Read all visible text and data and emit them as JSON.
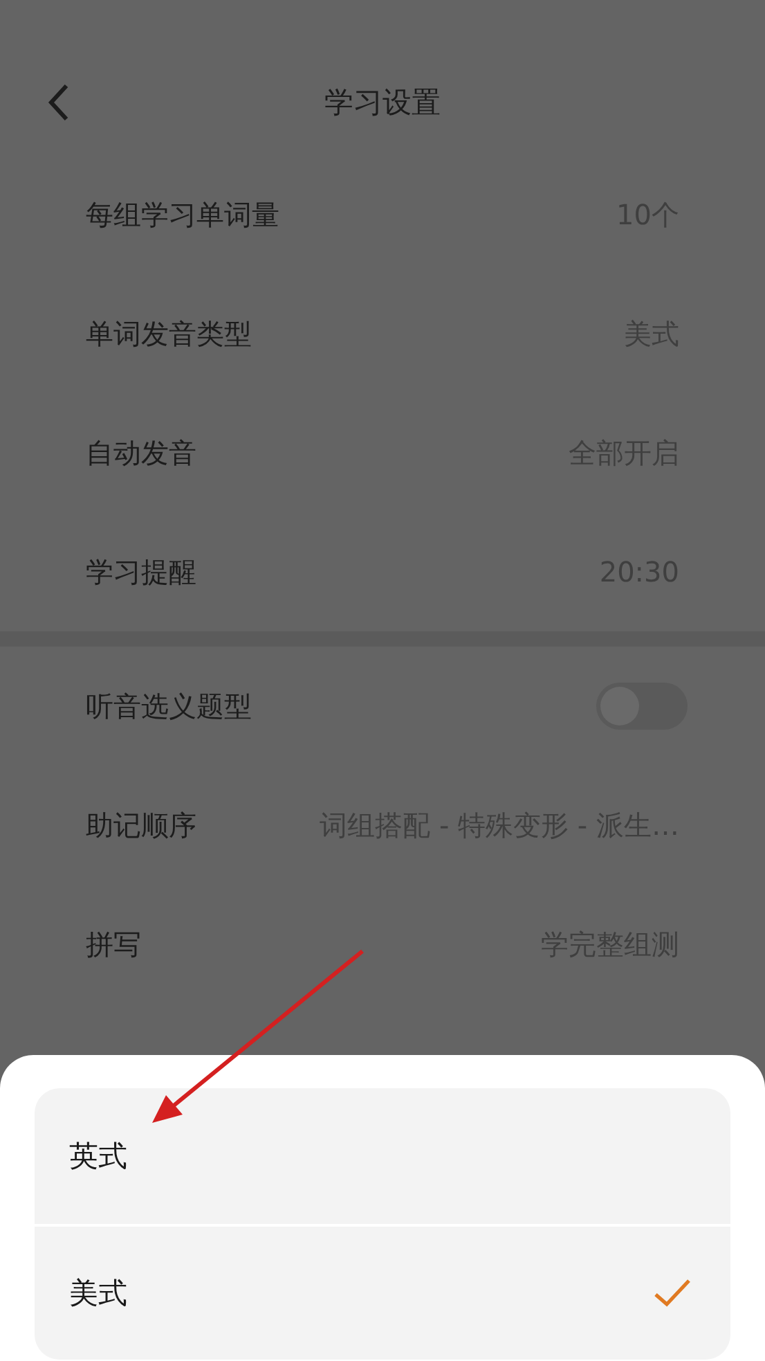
{
  "header": {
    "title": "学习设置"
  },
  "groups": [
    {
      "rows": [
        {
          "kind": "value",
          "label": "每组学习单词量",
          "value": "10个"
        },
        {
          "kind": "value",
          "label": "单词发音类型",
          "value": "美式"
        },
        {
          "kind": "value",
          "label": "自动发音",
          "value": "全部开启"
        },
        {
          "kind": "value",
          "label": "学习提醒",
          "value": "20:30"
        }
      ]
    },
    {
      "rows": [
        {
          "kind": "toggle",
          "label": "听音选义题型",
          "on": false
        },
        {
          "kind": "value",
          "label": "助记顺序",
          "value": "词组搭配 - 特殊变形 - 派生…"
        },
        {
          "kind": "value",
          "label": "拼写",
          "value": "学完整组测"
        }
      ]
    }
  ],
  "sheet": {
    "options": [
      {
        "label": "英式",
        "selected": false
      },
      {
        "label": "美式",
        "selected": true
      }
    ]
  }
}
